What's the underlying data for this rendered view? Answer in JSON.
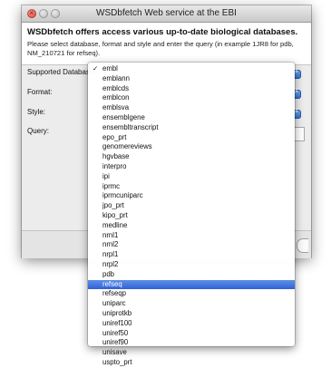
{
  "window": {
    "title": "WSDbfetch Web service at the EBI",
    "close_glyph": "×"
  },
  "header": {
    "heading": "WSDbfetch offers access various up-to-date biological databases.",
    "description": "Please select database, format and style and enter the query (in example 1JR8 for pdb, NM_210721 for refseq)."
  },
  "form": {
    "database_label": "Supported Databases",
    "format_label": "Format:",
    "style_label": "Style:",
    "query_label": "Query:",
    "popup_arrow": "⇕"
  },
  "menu": {
    "check_glyph": "✓",
    "checked": "embl",
    "highlighted": "refseq",
    "items": [
      "embl",
      "emblann",
      "emblcds",
      "emblcon",
      "emblsva",
      "ensemblgene",
      "ensembltranscript",
      "epo_prt",
      "genomereviews",
      "hgvbase",
      "interpro",
      "ipi",
      "iprmc",
      "iprmcuniparc",
      "jpo_prt",
      "kipo_prt",
      "medline",
      "nrnl1",
      "nrnl2",
      "nrpl1",
      "nrpl2",
      "pdb",
      "refseq",
      "refseqp",
      "uniparc",
      "uniprotkb",
      "uniref100",
      "uniref50",
      "uniref90",
      "unisave",
      "uspto_prt"
    ]
  },
  "colors": {
    "accent": "#2f62d6",
    "window_bg": "#ececec"
  }
}
